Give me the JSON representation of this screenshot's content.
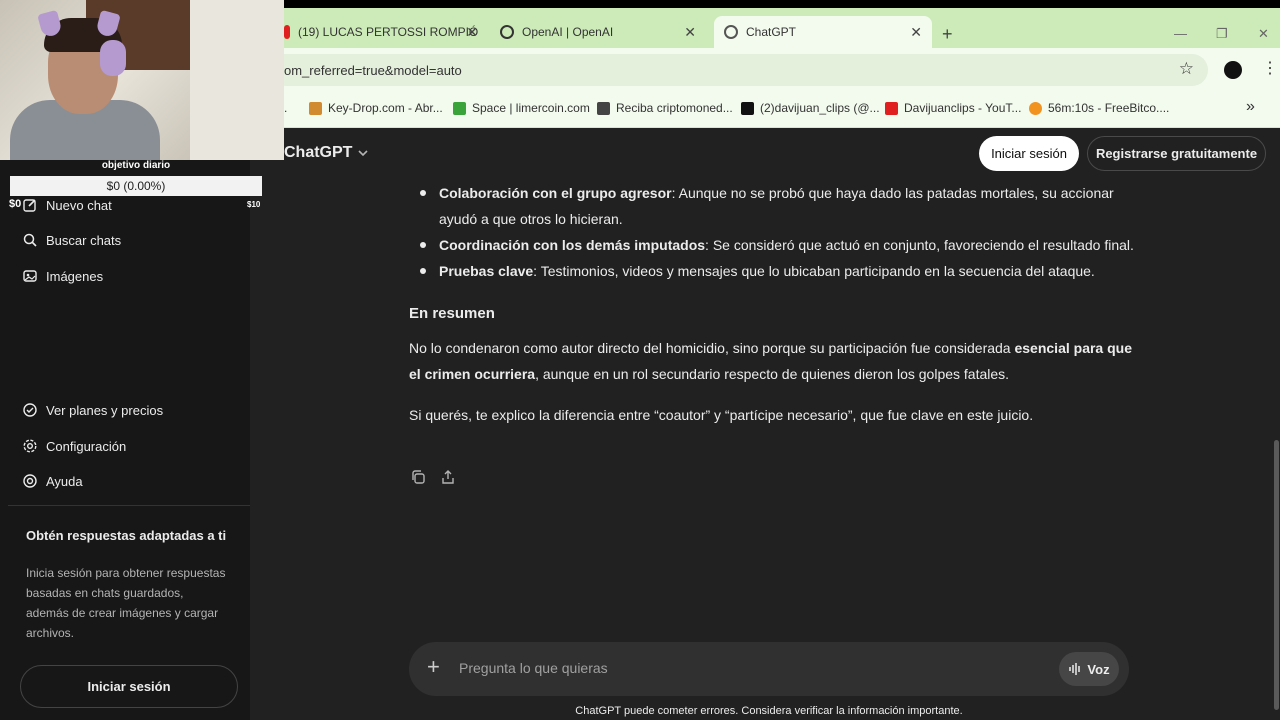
{
  "browser": {
    "tabs": [
      {
        "label": "(19) LUCAS PERTOSSI ROMPIÓ ",
        "active": false
      },
      {
        "label": "OpenAI | OpenAI",
        "active": false
      },
      {
        "label": "ChatGPT",
        "active": true
      }
    ],
    "address": "om_referred=true&model=auto",
    "bookmarks": [
      {
        "label": "Key-Drop.com - Abr..."
      },
      {
        "label": "Space | limercoin.com"
      },
      {
        "label": "Reciba criptomoned..."
      },
      {
        "label": "(2)davijuan_clips (@..."
      },
      {
        "label": "Davijuanclips - YouT..."
      },
      {
        "label": "56m:10s - FreeBitco...."
      }
    ],
    "bookmark_lead": "."
  },
  "overlay": {
    "goal_label": "objetivo diario",
    "goal_value": "$0 (0.00%)",
    "goal_progress_percent": 0,
    "goal_min": "$0",
    "goal_max": "$10"
  },
  "sidebar": {
    "items": [
      {
        "label": "Nuevo chat",
        "icon": "edit-icon"
      },
      {
        "label": "Buscar chats",
        "icon": "search-icon"
      },
      {
        "label": "Imágenes",
        "icon": "images-icon"
      },
      {
        "label": "Ver planes y precios",
        "icon": "plans-icon"
      },
      {
        "label": "Configuración",
        "icon": "gear-icon"
      },
      {
        "label": "Ayuda",
        "icon": "help-icon"
      }
    ],
    "promo_title": "Obtén respuestas adaptadas a ti",
    "promo_text": "Inicia sesión para obtener respuestas basadas en chats guardados, además de crear imágenes y cargar archivos.",
    "login_button": "Iniciar sesión"
  },
  "header": {
    "model_label": "ChatGPT",
    "login_button": "Iniciar sesión",
    "register_button": "Registrarse gratuitamente"
  },
  "message": {
    "bullets": [
      {
        "strong": "Colaboración con el grupo agresor",
        "text": ": Aunque no se probó que haya dado las patadas mortales, su accionar ayudó a que otros lo hicieran."
      },
      {
        "strong": "Coordinación con los demás imputados",
        "text": ": Se consideró que actuó en conjunto, favoreciendo el resultado final."
      },
      {
        "strong": "Pruebas clave",
        "text": ": Testimonios, videos y mensajes que lo ubicaban participando en la secuencia del ataque."
      }
    ],
    "section_title": "En resumen",
    "summary_pre": "No lo condenaron como autor directo del homicidio, sino porque su participación fue considerada ",
    "summary_strong": "esencial para que el crimen ocurriera",
    "summary_post": ", aunque en un rol secundario respecto de quienes dieron los golpes fatales.",
    "followup": "Si querés, te explico la diferencia entre “coautor” y “partícipe necesario”, que fue clave en este juicio."
  },
  "composer": {
    "placeholder": "Pregunta lo que quieras",
    "voice_label": "Voz"
  },
  "footer": {
    "note": "ChatGPT puede cometer errores. Considera verificar la información importante."
  },
  "colors": {
    "sidebar_bg": "#171717",
    "main_bg": "#212121",
    "browser_accent": "#cdebb8"
  }
}
